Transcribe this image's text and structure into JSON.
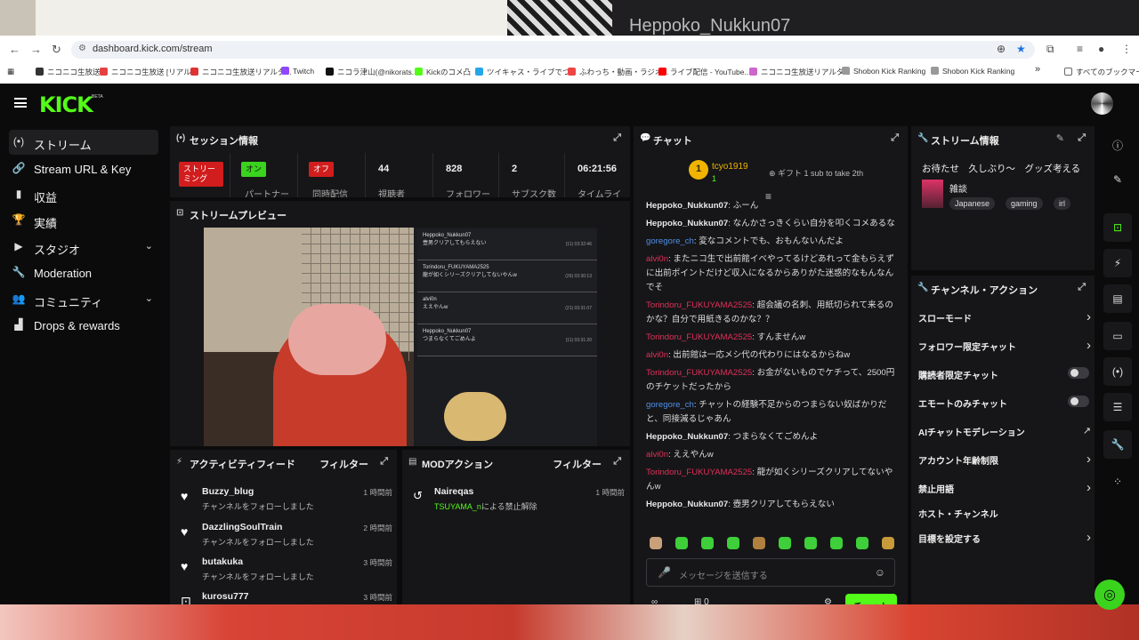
{
  "background_title": "Heppoko_Nukkun07",
  "browser": {
    "url": "dashboard.kick.com/stream",
    "bookmarks": [
      "ニコニコ生放送",
      "ニコニコ生放送 [リアル...",
      "ニコニコ生放送リアルタ...",
      "Twitch",
      "ニコラ津山(@nikorats...",
      "Kickのコメ凸",
      "ツイキャス・ライブでつ...",
      "ふわっち・動画・ラジオ...",
      "ライブ配信 - YouTube...",
      "ニコニコ生放送リアルタ...",
      "Shobon Kick Ranking",
      "Shobon Kick Ranking"
    ],
    "all_bookmarks": "すべてのブックマーク",
    "more": "»"
  },
  "app": {
    "logo": "KICK",
    "beta": "BETA"
  },
  "sidebar": {
    "items": [
      {
        "label": "ストリーム",
        "icon": "(•)"
      },
      {
        "label": "Stream URL & Key",
        "icon": "🔗"
      },
      {
        "label": "収益",
        "icon": "▮"
      },
      {
        "label": "実績",
        "icon": "🏆"
      },
      {
        "label": "スタジオ",
        "icon": "▶",
        "chevron": "⌄"
      },
      {
        "label": "Moderation",
        "icon": "🔧"
      },
      {
        "label": "コミュニティ",
        "icon": "👥",
        "chevron": "⌄"
      },
      {
        "label": "Drops & rewards",
        "icon": "▟"
      }
    ]
  },
  "session": {
    "title": "セッション情報",
    "stats": [
      {
        "value": "ストリーミング",
        "label": ""
      },
      {
        "value": "オン",
        "label": "パートナー"
      },
      {
        "value": "オフ",
        "label": "同時配信"
      },
      {
        "value": "44",
        "label": "視聴者"
      },
      {
        "value": "828",
        "label": "フォロワー"
      },
      {
        "value": "2",
        "label": "サブスク数"
      },
      {
        "value": "06:21:56",
        "label": "タイムライ"
      }
    ]
  },
  "preview": {
    "title": "ストリームプレビュー",
    "overlay": [
      {
        "user": "Heppoko_Nukkun07",
        "text": "壺男クリアしてもらえない",
        "time": "(11) 03:32:46"
      },
      {
        "user": "Torindoru_FUKUYAMA2525",
        "text": "龍が如くシリーズクリアしてないやんw",
        "time": "(26) 03:30:13"
      },
      {
        "user": "alvi0n",
        "text": "ええやんw",
        "time": "(21) 03:31:07"
      },
      {
        "user": "Heppoko_Nukkun07",
        "text": "つまらなくてごめんよ",
        "time": "(11) 03:31:20"
      }
    ]
  },
  "activity": {
    "title": "アクティビティフィード",
    "filter": "フィルター",
    "items": [
      {
        "name": "Buzzy_blug",
        "sub": "チャンネルをフォローしました",
        "time": "1 時間前"
      },
      {
        "name": "DazzlingSoulTrain",
        "sub": "チャンネルをフォローしました",
        "time": "2 時間前"
      },
      {
        "name": "butakuka",
        "sub": "チャンネルをフォローしました",
        "time": "3 時間前"
      },
      {
        "name": "kurosu777",
        "sub": "",
        "time": "3 時間前"
      }
    ]
  },
  "mod": {
    "title": "MODアクション",
    "filter": "フィルター",
    "item": {
      "name": "Naireqas",
      "sub_user": "TSUYAMA_n",
      "sub_text": "による禁止解除",
      "time": "1 時間前"
    }
  },
  "chat": {
    "title": "チャット",
    "pinned": {
      "user": "tcyo1919",
      "count": "1",
      "gift": "ギフト 1 sub to take 2th",
      "rank": "1"
    },
    "messages": [
      {
        "user": "Heppoko_Nukkun07",
        "cls": "u-g",
        "text": "ふーん"
      },
      {
        "user": "Heppoko_Nukkun07",
        "cls": "u-g",
        "text": "なんかさっきくらい自分を叩くコメあるな"
      },
      {
        "user": "goregore_ch",
        "cls": "u-b",
        "text": "変なコメントでも、おもんないんだよ"
      },
      {
        "user": "alvi0n",
        "cls": "u-o",
        "text": "またニコ生で出前館イベやってるけどあれって金もらえずに出前ポイントだけど収入になるからありがた迷惑的なもんなんでそ"
      },
      {
        "user": "Torindoru_FUKUYAMA2525",
        "cls": "u-r",
        "text": "超会議の名刺、用紙切られて来るのかな？自分で用紙きるのかな？？"
      },
      {
        "user": "Torindoru_FUKUYAMA2525",
        "cls": "u-r",
        "text": "すんませんw"
      },
      {
        "user": "alvi0n",
        "cls": "u-o",
        "text": "出前館は一応メシ代の代わりにはなるからねw"
      },
      {
        "user": "Torindoru_FUKUYAMA2525",
        "cls": "u-r",
        "text": "お金がないものでケチって、2500円のチケットだったから"
      },
      {
        "user": "goregore_ch",
        "cls": "u-b",
        "text": "チャットの経験不足からのつまらない奴ばかりだと、同接減るじゃあん"
      },
      {
        "user": "Heppoko_Nukkun07",
        "cls": "u-g",
        "text": "つまらなくてごめんよ"
      },
      {
        "user": "alvi0n",
        "cls": "u-o",
        "text": "ええやんw"
      },
      {
        "user": "Torindoru_FUKUYAMA2525",
        "cls": "u-r",
        "text": "龍が如くシリーズクリアしてないやんw"
      },
      {
        "user": "Heppoko_Nukkun07",
        "cls": "u-g",
        "text": "壺男クリアしてもらえない"
      }
    ],
    "input_placeholder": "メッセージを送信する",
    "send": "チャット",
    "points": "0"
  },
  "stream_info": {
    "title": "ストリーム情報",
    "stream_title": "お待たせ　久しぶり〜　グッズ考える",
    "category": "雑談",
    "tags": [
      "Japanese",
      "gaming",
      "irl"
    ]
  },
  "channel_actions": {
    "title": "チャンネル・アクション",
    "rows": [
      {
        "label": "スローモード",
        "kind": "arrow",
        "glyph": "›"
      },
      {
        "label": "フォロワー限定チャット",
        "kind": "arrow",
        "glyph": "›"
      },
      {
        "label": "購読者限定チャット",
        "kind": "toggle",
        "glyph": ""
      },
      {
        "label": "エモートのみチャット",
        "kind": "toggle",
        "glyph": ""
      },
      {
        "label": "AIチャットモデレーション",
        "kind": "ext",
        "glyph": "↗"
      },
      {
        "label": "アカウント年齢制限",
        "kind": "arrow",
        "glyph": "›"
      },
      {
        "label": "禁止用語",
        "kind": "arrow",
        "glyph": "›"
      },
      {
        "label": "ホスト・チャンネル",
        "kind": "none",
        "glyph": ""
      },
      {
        "label": "目標を設定する",
        "kind": "arrow",
        "glyph": "›"
      }
    ]
  }
}
